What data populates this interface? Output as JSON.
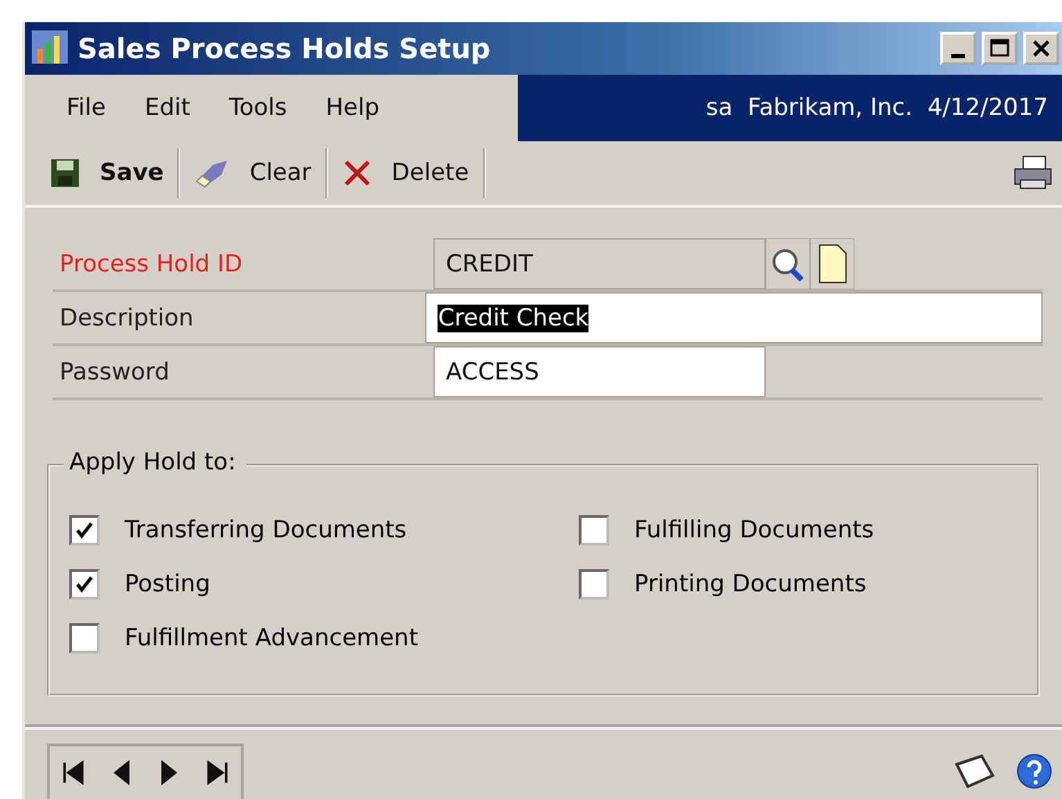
{
  "window": {
    "title": "Sales Process Holds Setup"
  },
  "menu": [
    "File",
    "Edit",
    "Tools",
    "Help"
  ],
  "session": "sa  Fabrikam, Inc.  4/12/2017",
  "toolbar": [
    {
      "kind": "save",
      "label": "Save"
    },
    {
      "kind": "clear",
      "label": "Clear"
    },
    {
      "kind": "delete",
      "label": "Delete"
    }
  ],
  "fields": [
    {
      "label": "Process Hold ID",
      "required": true,
      "value": "CREDIT",
      "kind": "lookup",
      "selected": false
    },
    {
      "label": "Description",
      "required": false,
      "value": "Credit Check",
      "kind": "wide",
      "selected": true
    },
    {
      "label": "Password",
      "required": false,
      "value": "ACCESS",
      "kind": "short",
      "selected": false
    }
  ],
  "apply_hold": {
    "title": "Apply Hold to:",
    "columns": [
      [
        {
          "label": "Transferring Documents",
          "checked": true
        },
        {
          "label": "Posting",
          "checked": true
        },
        {
          "label": "Fulfillment Advancement",
          "checked": false
        }
      ],
      [
        {
          "label": "Fulfilling Documents",
          "checked": false
        },
        {
          "label": "Printing Documents",
          "checked": false
        }
      ]
    ]
  }
}
